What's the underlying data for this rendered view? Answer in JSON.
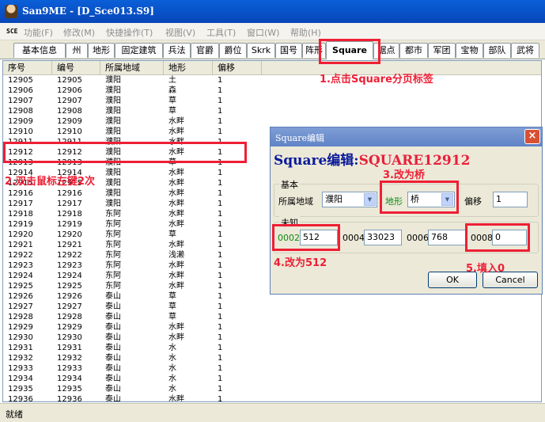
{
  "window": {
    "title": "San9ME - [D_Sce013.S9]"
  },
  "menubar": {
    "badge": "SCE",
    "items": [
      "功能(F)",
      "修改(M)",
      "快捷操作(T)",
      "视图(V)",
      "工具(T)",
      "窗口(W)",
      "帮助(H)"
    ]
  },
  "tabs": {
    "items": [
      "基本信息",
      "州",
      "地形",
      "固定建筑",
      "兵法",
      "官爵",
      "爵位",
      "Skrk",
      "国号",
      "阵形",
      "Square",
      "据点",
      "都市",
      "军团",
      "宝物",
      "部队",
      "武将"
    ],
    "active": "Square"
  },
  "grid": {
    "headers": [
      "序号",
      "编号",
      "所属地域",
      "地形",
      "偏移"
    ],
    "rows": [
      [
        "12905",
        "12905",
        "濮阳",
        "土",
        "1"
      ],
      [
        "12906",
        "12906",
        "濮阳",
        "森",
        "1"
      ],
      [
        "12907",
        "12907",
        "濮阳",
        "草",
        "1"
      ],
      [
        "12908",
        "12908",
        "濮阳",
        "草",
        "1"
      ],
      [
        "12909",
        "12909",
        "濮阳",
        "水畔",
        "1"
      ],
      [
        "12910",
        "12910",
        "濮阳",
        "水畔",
        "1"
      ],
      [
        "12911",
        "12911",
        "濮阳",
        "水畔",
        "1"
      ],
      [
        "12912",
        "12912",
        "濮阳",
        "水畔",
        "1"
      ],
      [
        "12913",
        "12913",
        "濮阳",
        "草",
        "1"
      ],
      [
        "12914",
        "12914",
        "濮阳",
        "水畔",
        "1"
      ],
      [
        "12915",
        "12915",
        "濮阳",
        "水畔",
        "1"
      ],
      [
        "12916",
        "12916",
        "濮阳",
        "水畔",
        "1"
      ],
      [
        "12917",
        "12917",
        "濮阳",
        "水畔",
        "1"
      ],
      [
        "12918",
        "12918",
        "东阿",
        "水畔",
        "1"
      ],
      [
        "12919",
        "12919",
        "东阿",
        "水畔",
        "1"
      ],
      [
        "12920",
        "12920",
        "东阿",
        "草",
        "1"
      ],
      [
        "12921",
        "12921",
        "东阿",
        "水畔",
        "1"
      ],
      [
        "12922",
        "12922",
        "东阿",
        "浅濑",
        "1"
      ],
      [
        "12923",
        "12923",
        "东阿",
        "水畔",
        "1"
      ],
      [
        "12924",
        "12924",
        "东阿",
        "水畔",
        "1"
      ],
      [
        "12925",
        "12925",
        "东阿",
        "水畔",
        "1"
      ],
      [
        "12926",
        "12926",
        "泰山",
        "草",
        "1"
      ],
      [
        "12927",
        "12927",
        "泰山",
        "草",
        "1"
      ],
      [
        "12928",
        "12928",
        "泰山",
        "草",
        "1"
      ],
      [
        "12929",
        "12929",
        "泰山",
        "水畔",
        "1"
      ],
      [
        "12930",
        "12930",
        "泰山",
        "水畔",
        "1"
      ],
      [
        "12931",
        "12931",
        "泰山",
        "水",
        "1"
      ],
      [
        "12932",
        "12932",
        "泰山",
        "水",
        "1"
      ],
      [
        "12933",
        "12933",
        "泰山",
        "水",
        "1"
      ],
      [
        "12934",
        "12934",
        "泰山",
        "水",
        "1"
      ],
      [
        "12935",
        "12935",
        "泰山",
        "水",
        "1"
      ],
      [
        "12936",
        "12936",
        "泰山",
        "水畔",
        "1"
      ]
    ]
  },
  "statusbar": {
    "text": "就绪"
  },
  "dialog": {
    "title": "Square编辑",
    "heading_label": "Square编辑:",
    "heading_id": "SQUARE12912",
    "basic": {
      "group_label": "基本",
      "region_label": "所属地域",
      "region_value": "濮阳",
      "terrain_label": "地形",
      "terrain_value": "桥",
      "offset_label": "偏移",
      "offset_value": "1"
    },
    "unknown": {
      "group_label": "未知",
      "f0002_label": "0002",
      "f0002_value": "512",
      "f0004_label": "0004",
      "f0004_value": "33023",
      "f0006_label": "0006",
      "f0006_value": "768",
      "f0008_label": "0008",
      "f0008_value": "0"
    },
    "ok_label": "OK",
    "cancel_label": "Cancel",
    "label_accent_color": "#0c8a12"
  },
  "annotations": {
    "step1": "1.点击Square分页标签",
    "step2": "2.双击鼠标左键2次",
    "step3": "3.改为桥",
    "step4": "4.改为512",
    "step5": "5.填入0",
    "color": "#ee1f35"
  }
}
